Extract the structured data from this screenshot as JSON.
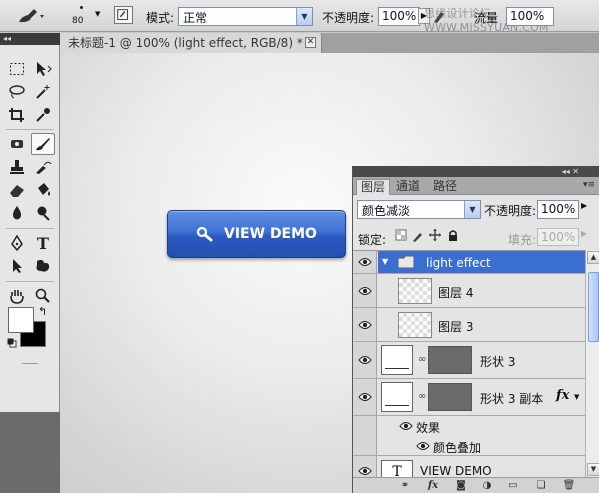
{
  "options_bar": {
    "brush_size": "80",
    "mode_label": "模式:",
    "mode_value": "正常",
    "opacity_label": "不透明度:",
    "opacity_value": "100%",
    "flow_label": "流量",
    "flow_value": "100%",
    "watermark": "思缘设计论坛 WWW.MISSYUAN.COM"
  },
  "document": {
    "tab_title": "未标题-1 @ 100% (light effect, RGB/8) *",
    "close_glyph": "✕",
    "button_text": "VIEW DEMO"
  },
  "tools": {
    "toolbox_collapse": "◂◂"
  },
  "layers_panel": {
    "collapse_glyph": "◂◂ ✕",
    "menu_glyph": "▾≡",
    "tabs": [
      "图层",
      "通道",
      "路径"
    ],
    "blend_mode": "颜色减淡",
    "opacity_label": "不透明度:",
    "opacity_value": "100%",
    "lock_label": "锁定:",
    "fill_label": "填充:",
    "fill_value": "100%",
    "layers": [
      {
        "name": "light effect",
        "type": "group"
      },
      {
        "name": "图层 4",
        "type": "pixel"
      },
      {
        "name": "图层 3",
        "type": "pixel"
      },
      {
        "name": "形状 3",
        "type": "shape"
      },
      {
        "name": "形状 3 副本",
        "type": "shape",
        "fx": "fx"
      },
      {
        "name": "效果",
        "type": "effects"
      },
      {
        "name": "颜色叠加",
        "type": "effect"
      },
      {
        "name": "VIEW DEMO",
        "type": "text"
      }
    ]
  },
  "colors": {
    "foreground": "#ffffff",
    "background": "#000000",
    "selection": "#3a6fd1",
    "button_blue": "#3f72d6"
  }
}
